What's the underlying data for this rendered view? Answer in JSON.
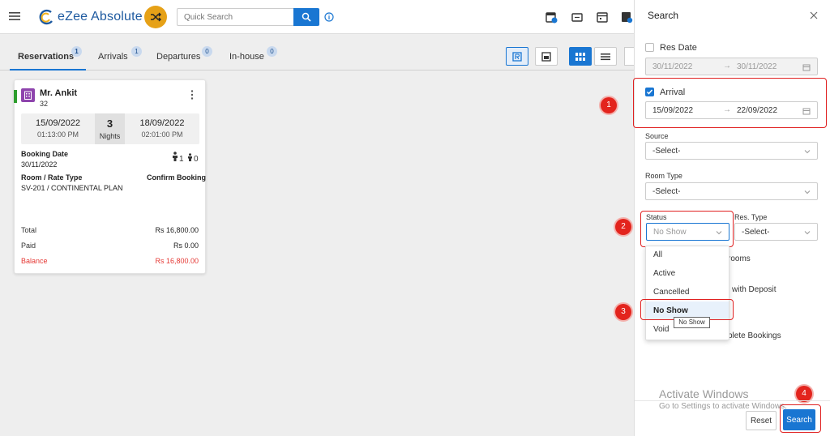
{
  "app": {
    "title": "eZee Absolute"
  },
  "search": {
    "placeholder": "Quick Search"
  },
  "tabs": [
    {
      "label": "Reservations",
      "count": "1"
    },
    {
      "label": "Arrivals",
      "count": "1"
    },
    {
      "label": "Departures",
      "count": "0"
    },
    {
      "label": "In-house",
      "count": "0"
    }
  ],
  "card": {
    "guest_name": "Mr. Ankit",
    "guest_sub": "32",
    "checkin_date": "15/09/2022",
    "checkin_time": "01:13:00 PM",
    "nights": "3",
    "nights_label": "Nights",
    "checkout_date": "18/09/2022",
    "checkout_time": "02:01:00 PM",
    "booking_date_label": "Booking Date",
    "booking_date": "30/11/2022",
    "adults": "1",
    "children": "0",
    "room_rate_label": "Room / Rate Type",
    "booking_status": "Confirm Booking",
    "room_rate": "SV-201 / CONTINENTAL PLAN",
    "total_label": "Total",
    "total": "Rs 16,800.00",
    "paid_label": "Paid",
    "paid": "Rs 0.00",
    "balance_label": "Balance",
    "balance": "Rs 16,800.00"
  },
  "panel": {
    "title": "Search",
    "res_date_label": "Res Date",
    "res_date_from": "30/11/2022",
    "res_date_to": "30/11/2022",
    "arrival_label": "Arrival",
    "arrival_from": "15/09/2022",
    "arrival_to": "22/09/2022",
    "source_label": "Source",
    "source_value": "-Select-",
    "room_type_label": "Room Type",
    "room_type_value": "-Select-",
    "status_label": "Status",
    "status_value": "No Show",
    "res_type_label": "Res. Type",
    "res_type_value": "-Select-",
    "hidden_text_1": "rooms",
    "hidden_text_2": "l with Deposit",
    "hidden_text_3": "plete Bookings",
    "status_options": [
      "All",
      "Active",
      "Cancelled",
      "No Show",
      "Void"
    ],
    "tooltip": "No Show",
    "reset_label": "Reset",
    "search_label": "Search"
  },
  "watermark": {
    "line1": "Activate Windows",
    "line2": "Go to Settings to activate Windows."
  },
  "steps": [
    "1",
    "2",
    "3",
    "4"
  ],
  "colors": {
    "primary": "#1976d2",
    "annotation": "#e3241d",
    "balance": "#e53935",
    "logo_badge": "#e6a117"
  }
}
